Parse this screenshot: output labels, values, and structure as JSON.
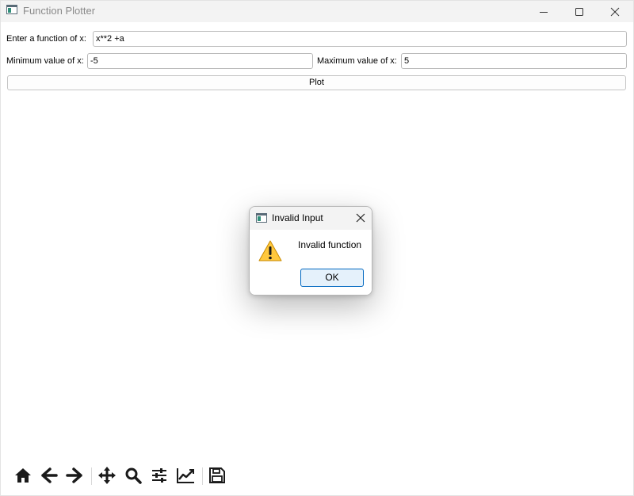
{
  "window": {
    "title": "Function Plotter"
  },
  "form": {
    "function_label": "Enter a function of x:",
    "function_value": "x**2 +a",
    "min_label": "Minimum value of x:",
    "min_value": "-5",
    "max_label": "Maximum value of x:",
    "max_value": "5",
    "plot_button": "Plot"
  },
  "toolbar": {
    "icons": [
      "home-icon",
      "back-arrow-icon",
      "forward-arrow-icon",
      "pan-icon",
      "zoom-icon",
      "configure-subplots-icon",
      "edit-axis-icon",
      "save-icon"
    ]
  },
  "dialog": {
    "title": "Invalid Input",
    "message": "Invalid function",
    "ok_button": "OK",
    "icon": "warning-icon"
  },
  "colors": {
    "accent": "#0067c0",
    "warning": "#ffc83d",
    "icon": "#1a1a1a"
  }
}
